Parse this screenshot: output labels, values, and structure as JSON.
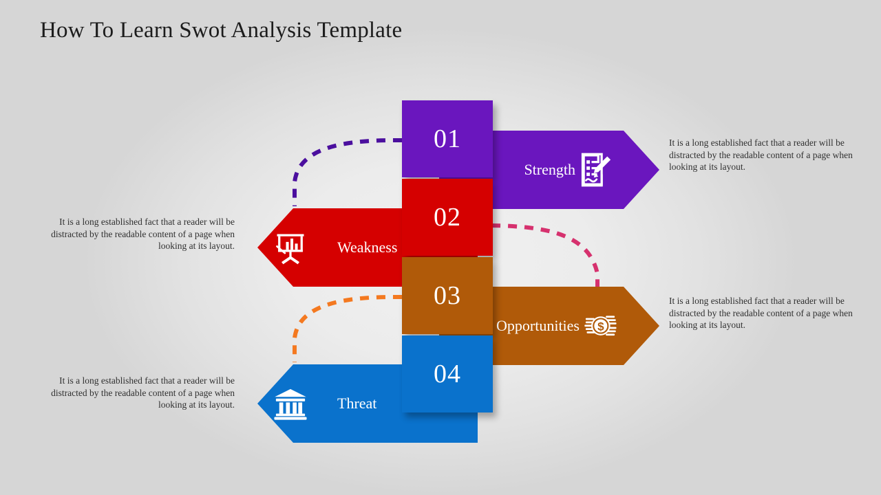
{
  "slide": {
    "title": "How To Learn Swot Analysis Template",
    "background_color": "#e6e6e6"
  },
  "body_text": "It is a long established fact that a reader will be distracted by the readable content of a page when looking at its layout.",
  "items": [
    {
      "number": "01",
      "label": "Strength",
      "color": "#6a16be",
      "shadow_color": "#4a0f85",
      "icon": "document-pen-icon",
      "direction": "right",
      "text": "It is a long established fact that a reader will be distracted by the readable content of a page when looking at its layout."
    },
    {
      "number": "02",
      "label": "Weakness",
      "color": "#d50000",
      "shadow_color": "#960000",
      "icon": "presentation-chart-icon",
      "direction": "left",
      "text": "It is a long established fact that a reader will be distracted by the readable content of a page when looking at its layout."
    },
    {
      "number": "03",
      "label": "Opportunities",
      "color": "#b05a09",
      "shadow_color": "#7a3e06",
      "icon": "money-coins-icon",
      "direction": "right",
      "text": "It is a long established fact that a reader will be distracted by the readable content of a page when looking at its layout."
    },
    {
      "number": "04",
      "label": "Threat",
      "color": "#0a72cc",
      "shadow_color": "#07508f",
      "icon": "bank-building-icon",
      "direction": "left",
      "text": "It is a long established fact that a reader will be distracted by the readable content of a page when looking at its layout."
    }
  ],
  "connectors": [
    {
      "name": "connector-strength-to-weakness",
      "color": "#4b0f9e"
    },
    {
      "name": "connector-weakness-to-opportunities",
      "color": "#d6316e"
    },
    {
      "name": "connector-opportunities-to-threat",
      "color": "#f47920"
    }
  ]
}
